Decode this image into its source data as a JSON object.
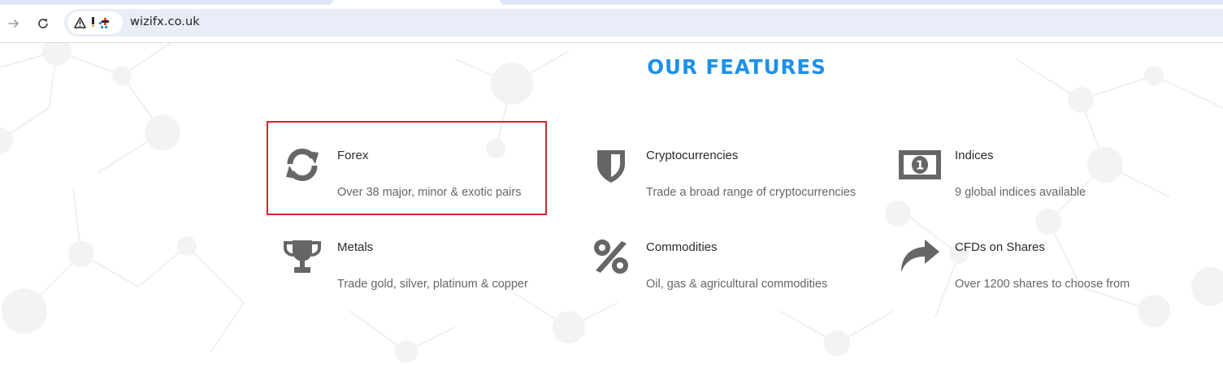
{
  "browser": {
    "url": "wizifx.co.uk",
    "icons": {
      "forward": "arrow-right-icon",
      "reload": "reload-icon",
      "security": "warning-triangle-icon"
    }
  },
  "section": {
    "title": "OUR FEATURES"
  },
  "features": [
    {
      "title": "Forex",
      "description": "Over 38 major, minor & exotic pairs",
      "icon": "refresh-arrows-icon"
    },
    {
      "title": "Cryptocurrencies",
      "description": "Trade a broad range of cryptocurrencies",
      "icon": "shield-icon"
    },
    {
      "title": "Indices",
      "description": "9 global indices available",
      "icon": "banknote-icon"
    },
    {
      "title": "Metals",
      "description": "Trade gold, silver, platinum & copper",
      "icon": "trophy-icon"
    },
    {
      "title": "Commodities",
      "description": "Oil, gas & agricultural commodities",
      "icon": "percent-icon"
    },
    {
      "title": "CFDs on Shares",
      "description": "Over 1200 shares to choose from",
      "icon": "share-arrow-icon"
    }
  ],
  "colors": {
    "accent": "#1e90e8",
    "icon": "#666666",
    "highlight": "#e0202a"
  }
}
